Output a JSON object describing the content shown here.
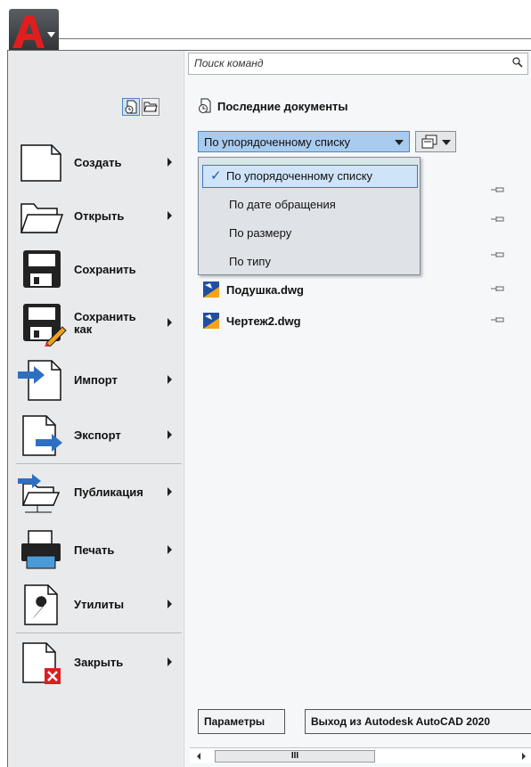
{
  "app": {
    "logo_letter": "A"
  },
  "search": {
    "placeholder": "Поиск команд"
  },
  "menu": [
    {
      "label": "Создать",
      "submenu": true
    },
    {
      "label": "Открыть",
      "submenu": true
    },
    {
      "label": "Сохранить",
      "submenu": false
    },
    {
      "label": "Сохранить как",
      "submenu": true
    },
    {
      "label": "Импорт",
      "submenu": true
    },
    {
      "label": "Экспорт",
      "submenu": true
    },
    {
      "label": "Публикация",
      "submenu": true
    },
    {
      "label": "Печать",
      "submenu": true
    },
    {
      "label": "Утилиты",
      "submenu": true
    },
    {
      "label": "Закрыть",
      "submenu": true
    }
  ],
  "recent": {
    "title": "Последние документы",
    "order_selected": "По упорядоченному списку",
    "order_options": [
      "По упорядоченному списку",
      "По дате обращения",
      "По размеру",
      "По типу"
    ],
    "files": [
      "Подушка.dwg",
      "Чертеж2.dwg"
    ]
  },
  "footer": {
    "options_button": "Параметры",
    "exit_button": "Выход из Autodesk AutoCAD 2020",
    "scroll_thumb": "III"
  },
  "colors": {
    "accent": "#3c78c8",
    "logo_red": "#d01f1f",
    "dropdown_bg": "#a9cbef"
  }
}
